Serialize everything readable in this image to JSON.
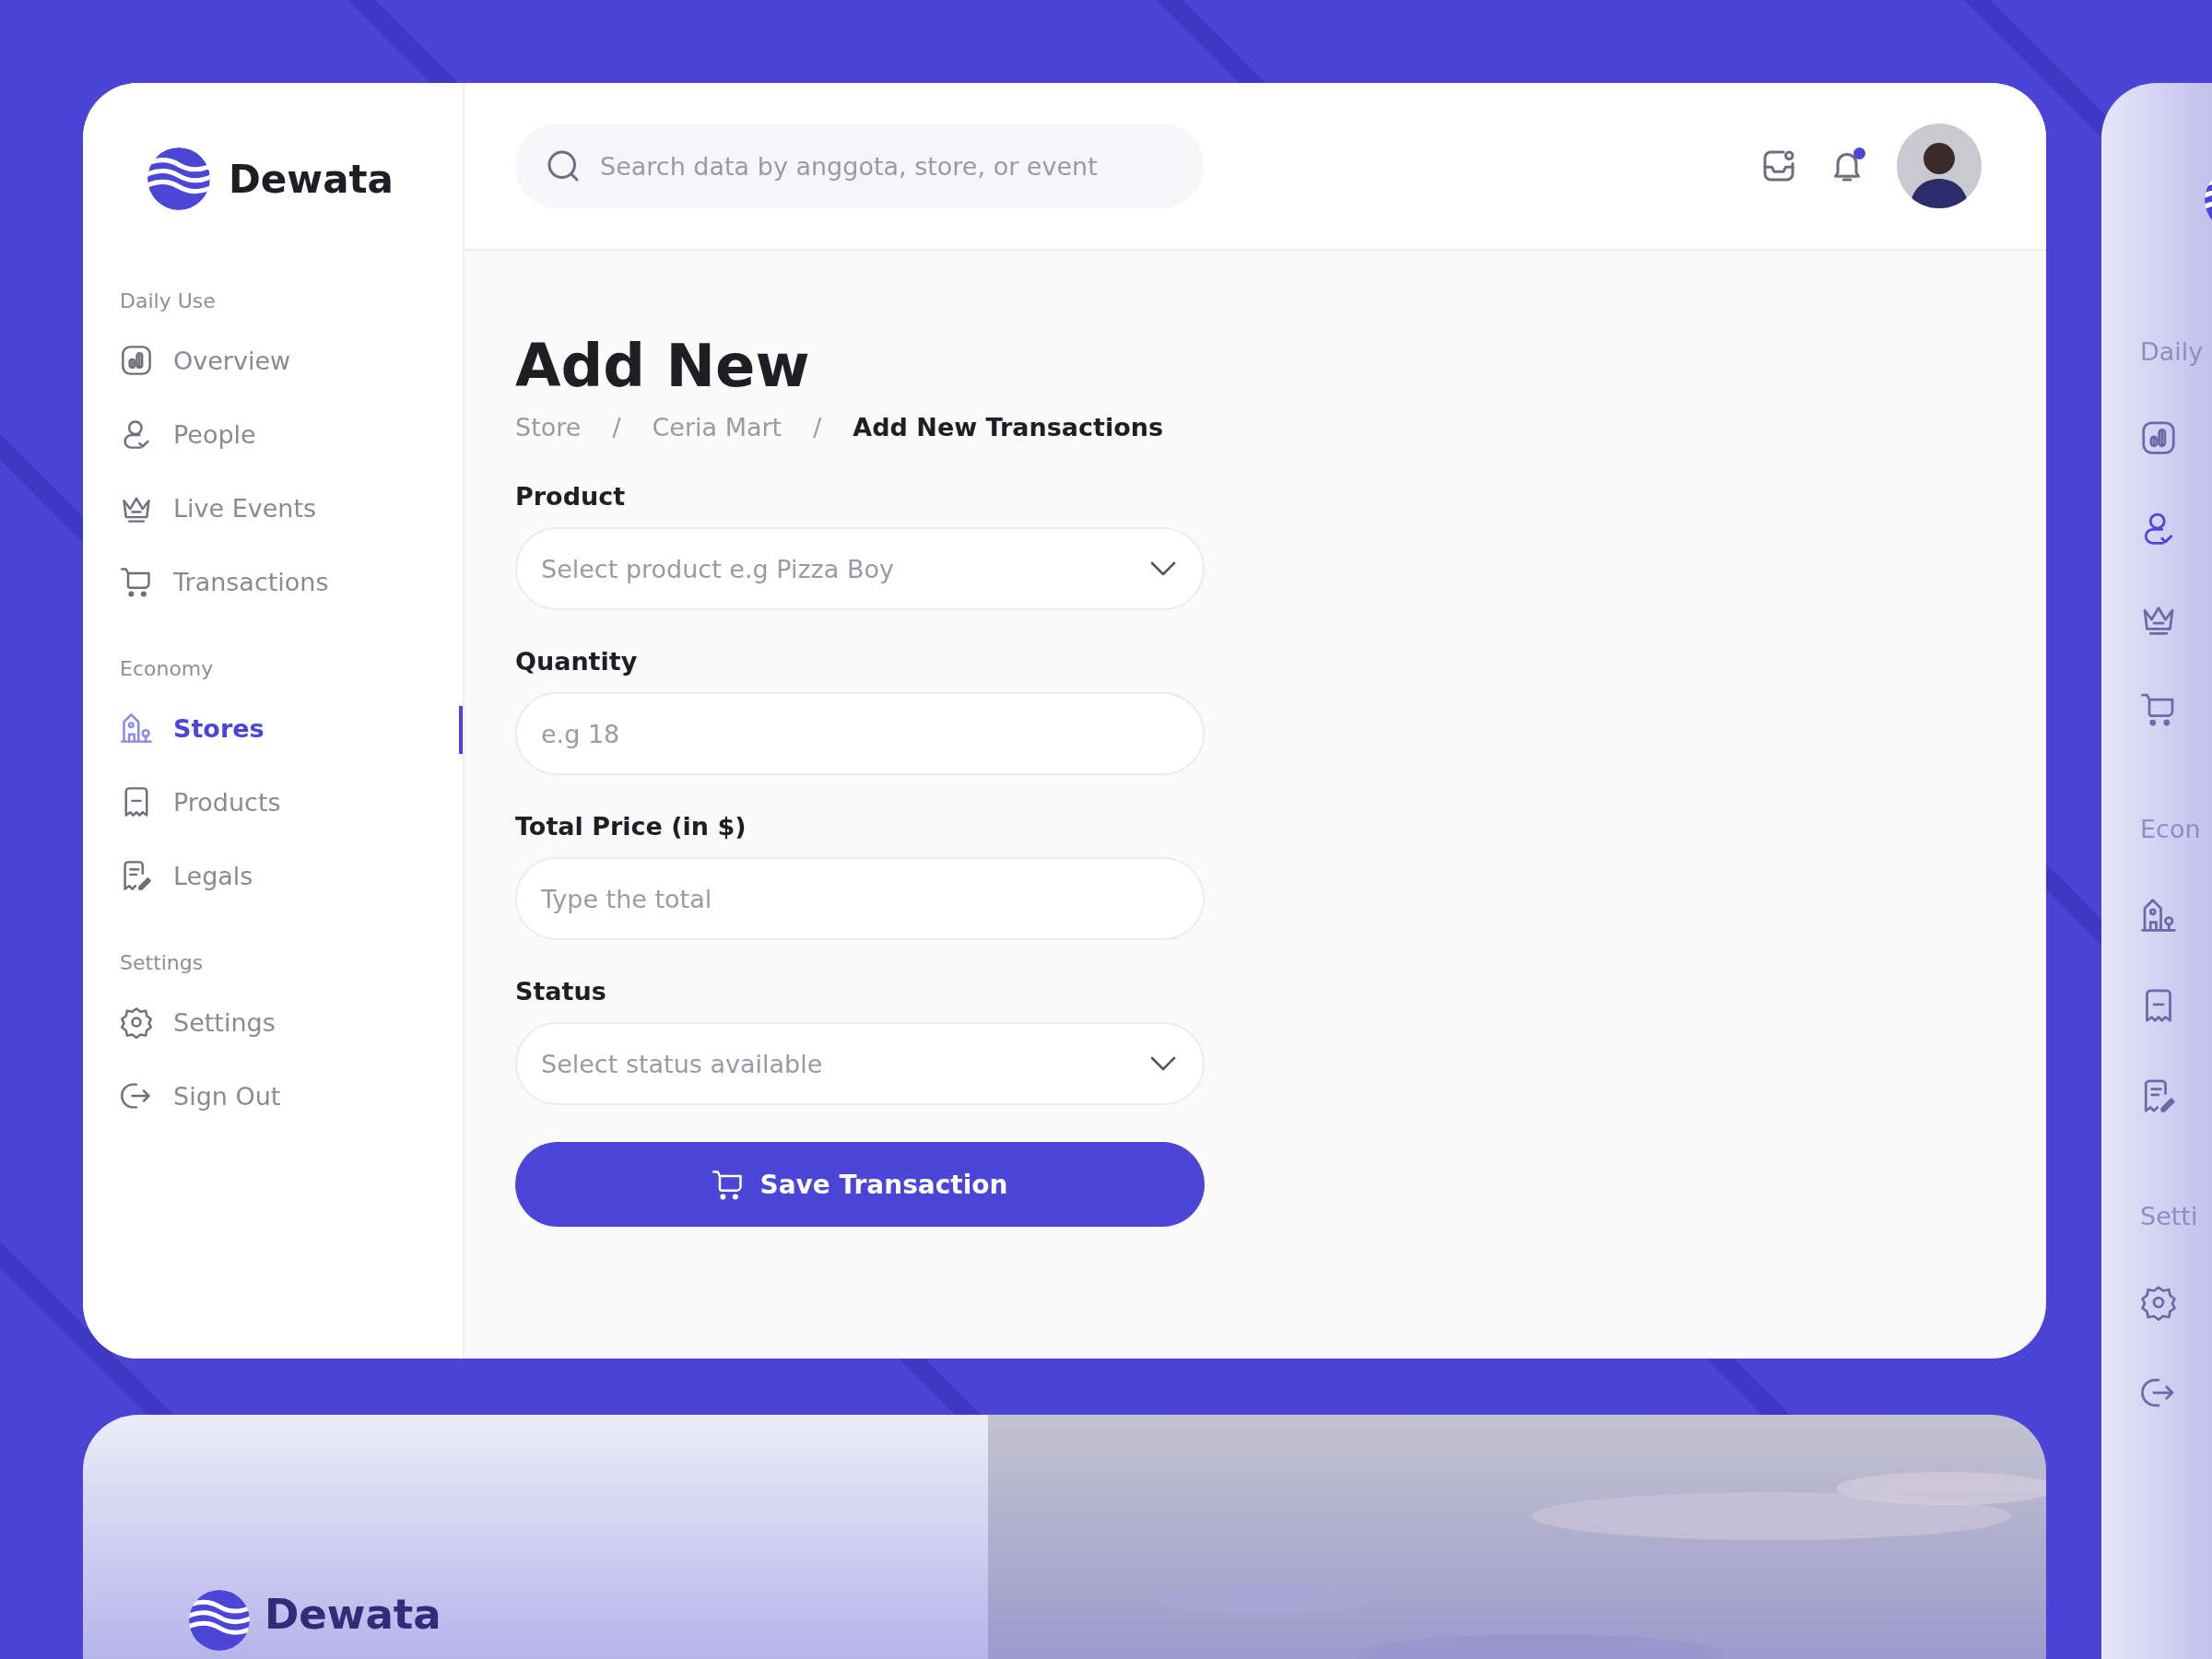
{
  "brand": {
    "name": "Dewata"
  },
  "sidebar": {
    "sections": [
      {
        "title": "Daily Use",
        "items": [
          {
            "label": "Overview",
            "selected": false
          },
          {
            "label": "People",
            "selected": false
          },
          {
            "label": "Live Events",
            "selected": false
          },
          {
            "label": "Transactions",
            "selected": false
          }
        ]
      },
      {
        "title": "Economy",
        "items": [
          {
            "label": "Stores",
            "selected": true
          },
          {
            "label": "Products",
            "selected": false
          },
          {
            "label": "Legals",
            "selected": false
          }
        ]
      },
      {
        "title": "Settings",
        "items": [
          {
            "label": "Settings",
            "selected": false
          },
          {
            "label": "Sign Out",
            "selected": false
          }
        ]
      }
    ]
  },
  "header": {
    "search": {
      "placeholder": "Search data by anggota, store, or event"
    },
    "notifications_unread": true
  },
  "page": {
    "title": "Add New",
    "breadcrumb": [
      "Store",
      "/",
      "Ceria Mart",
      "/",
      "Add New Transactions"
    ]
  },
  "form": {
    "fields": [
      {
        "label": "Product",
        "kind": "select",
        "placeholder": "Select product e.g Pizza Boy"
      },
      {
        "label": "Quantity",
        "kind": "input",
        "placeholder": "e.g 18"
      },
      {
        "label": "Total Price (in $)",
        "kind": "input",
        "placeholder": "Type the total"
      },
      {
        "label": "Status",
        "kind": "select",
        "placeholder": "Select status available"
      }
    ],
    "submit": "Save Transaction"
  },
  "side_preview": {
    "sections": [
      {
        "title": "Daily",
        "items": [
          {
            "selected": false
          },
          {
            "selected": true
          },
          {
            "selected": false
          },
          {
            "selected": false
          }
        ]
      },
      {
        "title": "Econ",
        "items": [
          {
            "selected": false
          },
          {
            "selected": false
          },
          {
            "selected": false
          }
        ]
      },
      {
        "title": "Setti",
        "items": [
          {
            "selected": false
          },
          {
            "selected": false
          }
        ]
      }
    ]
  },
  "bottom_preview": {
    "brand": "Dewata"
  }
}
